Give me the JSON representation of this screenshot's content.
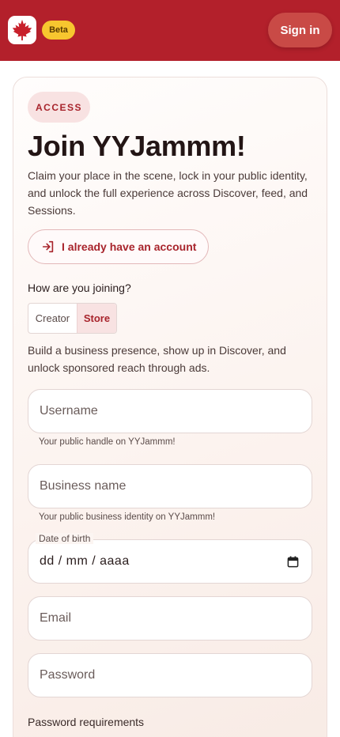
{
  "header": {
    "beta_label": "Beta",
    "signin_label": "Sign in",
    "logo_icon": "maple-leaf-icon",
    "bar_color": "#b3202b"
  },
  "form": {
    "badge": "ACCESS",
    "title": "Join YYJammm!",
    "intro": "Claim your place in the scene, lock in your public identity, and unlock the full experience across Discover, feed, and Sessions.",
    "have_account_label": "I already have an account",
    "have_account_icon": "login-arrow-icon",
    "join_question": "How are you joining?",
    "join_options": [
      "Creator",
      "Store"
    ],
    "join_selected": "Store",
    "store_description": "Build a business presence, show up in Discover, and unlock sponsored reach through ads.",
    "username": {
      "placeholder": "Username",
      "helper": "Your public handle on YYJammm!"
    },
    "business_name": {
      "placeholder": "Business name",
      "helper": "Your public business identity on YYJammm!"
    },
    "dob": {
      "label": "Date of birth",
      "value": "dd / mm / aaaa",
      "icon": "calendar-icon"
    },
    "email": {
      "placeholder": "Email"
    },
    "password": {
      "placeholder": "Password"
    },
    "password_requirements_label": "Password requirements"
  },
  "colors": {
    "accent": "#a8242c",
    "badge_bg": "#f8e2e2",
    "beta_bg": "#f7c62f"
  }
}
